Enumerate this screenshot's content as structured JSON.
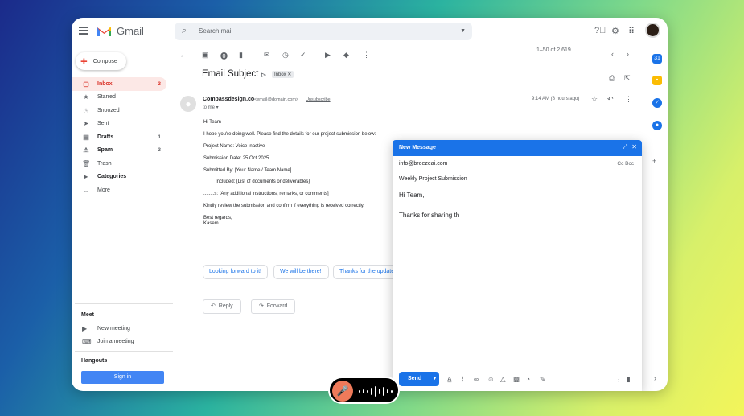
{
  "app": {
    "name": "Gmail"
  },
  "search": {
    "placeholder": "Search mail"
  },
  "compose_button": {
    "label": "Compose"
  },
  "nav": [
    {
      "label": "Inbox",
      "count": "3",
      "icon": "inbox-icon",
      "glyph": "▢",
      "active": true
    },
    {
      "label": "Starred",
      "count": "",
      "icon": "star-icon",
      "glyph": "★"
    },
    {
      "label": "Snoozed",
      "count": "",
      "icon": "clock-icon",
      "glyph": "◷"
    },
    {
      "label": "Sent",
      "count": "",
      "icon": "send-icon",
      "glyph": "➤"
    },
    {
      "label": "Drafts",
      "count": "1",
      "icon": "draft-icon",
      "glyph": "▤",
      "bold": true
    },
    {
      "label": "Spam",
      "count": "3",
      "icon": "spam-icon",
      "glyph": "⚠",
      "bold": true
    },
    {
      "label": "Trash",
      "count": "",
      "icon": "trash-icon",
      "glyph": "🗑"
    },
    {
      "label": "Categories",
      "count": "",
      "icon": "label-icon",
      "glyph": "▸",
      "bold": true
    },
    {
      "label": "More",
      "count": "",
      "icon": "chevron-down-icon",
      "glyph": "⌄"
    }
  ],
  "meet": {
    "title": "Meet",
    "new_meeting": "New meeting",
    "join_meeting": "Join a meeting"
  },
  "hangouts": {
    "title": "Hangouts",
    "sign_in": "Sign in"
  },
  "pager": "1–50 of 2,619",
  "email": {
    "subject": "Email Subject",
    "label": "Inbox",
    "sender_name": "Compassdesign.co",
    "sender_email": "<email@domain.com>",
    "unsubscribe": "Unsubscribe",
    "to": "to me",
    "time": "9:14 AM (8 hours ago)",
    "body": [
      "Hi Team",
      "I hope you're doing well. Please find the details for our project submission below:",
      "Project Name: Voice inactive",
      "Submission Date: 25 Oct 2025",
      "Submitted By: [Your Name / Team Name]",
      "Included: [List of documents or deliverables]",
      "........s: [Any additional instructions, remarks, or comments]",
      "Kindly review the submission and confirm if everything is received correctly.",
      "Best regards,",
      "Kasem"
    ]
  },
  "smart_replies": [
    "Looking forward to it!",
    "We will be there!",
    "Thanks for the update"
  ],
  "actions": {
    "reply": "Reply",
    "forward": "Forward"
  },
  "compose_window": {
    "title": "New Message",
    "to": "info@breezeai.com",
    "cc_bcc": "Cc Bcc",
    "subject": "Weekly Project Submission",
    "greeting": "Hi Team,",
    "draft": "Thanks for sharing th",
    "send": "Send"
  },
  "colors": {
    "accent": "#1a73e8",
    "inbox_active": "#d93025",
    "signin": "#4285f4",
    "mic": "#ef7a5a"
  }
}
